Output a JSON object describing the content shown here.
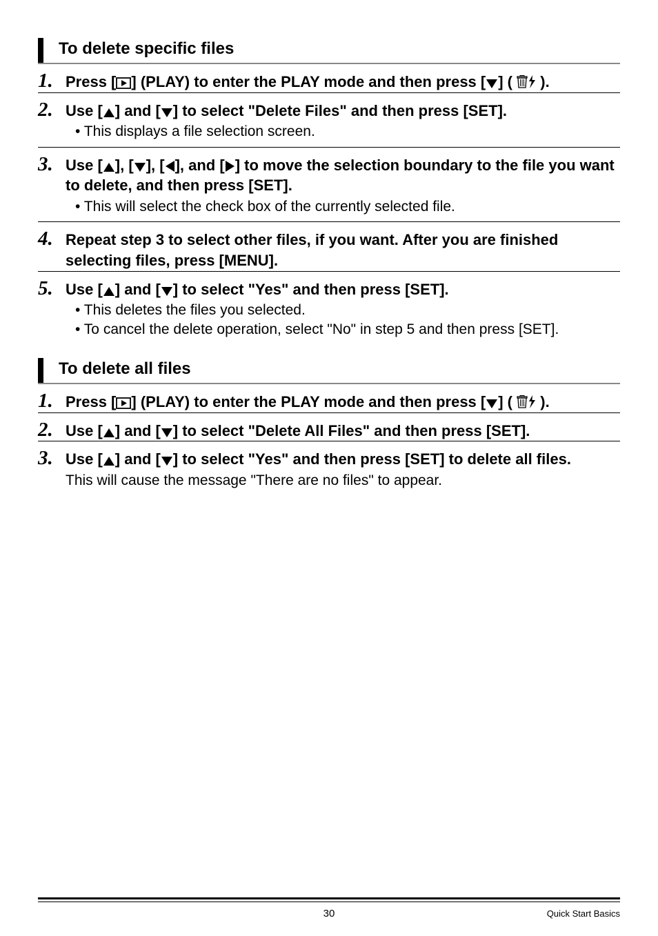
{
  "section1": {
    "title": "To delete specific files",
    "steps": [
      {
        "num": "1.",
        "parts": [
          {
            "t": "text",
            "bold": true,
            "v": "Press ["
          },
          {
            "t": "icon",
            "v": "play-box"
          },
          {
            "t": "text",
            "bold": true,
            "v": "] (PLAY) to enter the PLAY mode and then press ["
          },
          {
            "t": "icon",
            "v": "down-solid"
          },
          {
            "t": "text",
            "bold": true,
            "v": "] ( "
          },
          {
            "t": "icon",
            "v": "trash"
          },
          {
            "t": "icon",
            "v": "flash"
          },
          {
            "t": "text",
            "bold": true,
            "v": " )."
          }
        ]
      },
      {
        "num": "2.",
        "parts": [
          {
            "t": "text",
            "bold": true,
            "v": "Use ["
          },
          {
            "t": "icon",
            "v": "up-solid"
          },
          {
            "t": "text",
            "bold": true,
            "v": "] and ["
          },
          {
            "t": "icon",
            "v": "down-solid"
          },
          {
            "t": "text",
            "bold": true,
            "v": "] to select \"Delete Files\" and then press [SET]."
          }
        ],
        "bullets": [
          "• This displays a file selection screen."
        ]
      },
      {
        "num": "3.",
        "parts": [
          {
            "t": "text",
            "bold": true,
            "v": "Use ["
          },
          {
            "t": "icon",
            "v": "up-solid"
          },
          {
            "t": "text",
            "bold": true,
            "v": "], ["
          },
          {
            "t": "icon",
            "v": "down-solid"
          },
          {
            "t": "text",
            "bold": true,
            "v": "], ["
          },
          {
            "t": "icon",
            "v": "left-solid"
          },
          {
            "t": "text",
            "bold": true,
            "v": "], and ["
          },
          {
            "t": "icon",
            "v": "right-solid"
          },
          {
            "t": "text",
            "bold": true,
            "v": "] to move the selection boundary to the file you want to delete, and then press [SET]."
          }
        ],
        "bullets": [
          "• This will select the check box of the currently selected file."
        ]
      },
      {
        "num": "4.",
        "parts": [
          {
            "t": "text",
            "bold": true,
            "v": "Repeat step 3 to select other files, if you want. After you are finished selecting files, press [MENU]."
          }
        ]
      },
      {
        "num": "5.",
        "parts": [
          {
            "t": "text",
            "bold": true,
            "v": "Use ["
          },
          {
            "t": "icon",
            "v": "up-solid"
          },
          {
            "t": "text",
            "bold": true,
            "v": "] and ["
          },
          {
            "t": "icon",
            "v": "down-solid"
          },
          {
            "t": "text",
            "bold": true,
            "v": "] to select \"Yes\" and then press [SET]."
          }
        ],
        "bullets": [
          "• This deletes the files you selected.",
          "• To cancel the delete operation, select \"No\" in step 5 and then press [SET]."
        ]
      }
    ]
  },
  "section2": {
    "title": "To delete all files",
    "steps": [
      {
        "num": "1.",
        "parts": [
          {
            "t": "text",
            "bold": true,
            "v": "Press ["
          },
          {
            "t": "icon",
            "v": "play-box"
          },
          {
            "t": "text",
            "bold": true,
            "v": "] (PLAY) to enter the PLAY mode and then press ["
          },
          {
            "t": "icon",
            "v": "down-solid"
          },
          {
            "t": "text",
            "bold": true,
            "v": "] ( "
          },
          {
            "t": "icon",
            "v": "trash"
          },
          {
            "t": "icon",
            "v": "flash"
          },
          {
            "t": "text",
            "bold": true,
            "v": " )."
          }
        ]
      },
      {
        "num": "2.",
        "parts": [
          {
            "t": "text",
            "bold": true,
            "v": "Use ["
          },
          {
            "t": "icon",
            "v": "up-solid"
          },
          {
            "t": "text",
            "bold": true,
            "v": "] and ["
          },
          {
            "t": "icon",
            "v": "down-solid"
          },
          {
            "t": "text",
            "bold": true,
            "v": "] to select \"Delete All Files\" and then press [SET]."
          }
        ]
      },
      {
        "num": "3.",
        "parts": [
          {
            "t": "text",
            "bold": true,
            "v": "Use ["
          },
          {
            "t": "icon",
            "v": "up-solid"
          },
          {
            "t": "text",
            "bold": true,
            "v": "] and ["
          },
          {
            "t": "icon",
            "v": "down-solid"
          },
          {
            "t": "text",
            "bold": true,
            "v": "] to select \"Yes\" and then press [SET] to delete all files."
          }
        ],
        "note": "This will cause the message \"There are no files\" to appear."
      }
    ]
  },
  "footer": {
    "page": "30",
    "label": "Quick Start Basics"
  }
}
